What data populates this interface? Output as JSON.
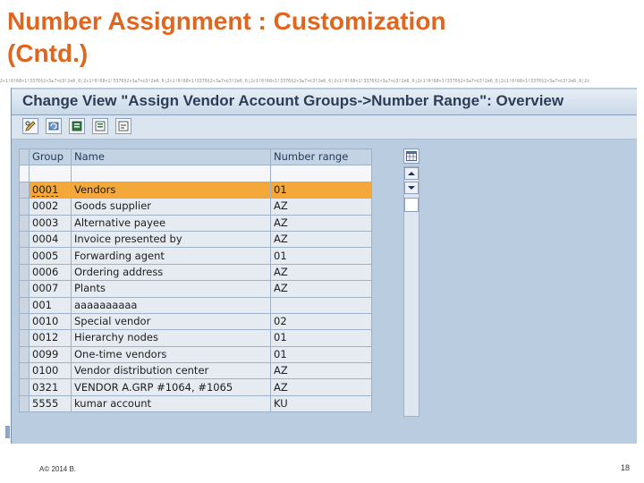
{
  "slide": {
    "title_line1": "Number Assignment : Customization",
    "title_line2": "(Cntd.)",
    "noise_text": "2×1!0!68×1!3376§2×3±7×©3!2e6¸6¦2c1!0!68×1!3376§2×3±7×©3!2e6¸6¦2c1!0!68×1!3376§2×3±7×©3!2e6¸6¦2c1!0!68×1!3376§2×3±7×©3!2e6¸6¦2c1!0!68×1!3376§2×3±7×©3!2e6¸6¦2c1!0!68×1!3376§2×3±7×©3!2e6¸6¦2c1!0!68×1!3376§2×3±7×©3!2e6¸6¦2c",
    "footer_left": "A© 2014 B.",
    "page_number": "18"
  },
  "window": {
    "title": "Change View \"Assign Vendor Account Groups->Number Range\": Overview"
  },
  "toolbar": {
    "buttons": [
      "pencil-glasses-icon",
      "refresh-icon",
      "export-icon",
      "import-icon",
      "details-icon"
    ]
  },
  "table": {
    "headers": {
      "group": "Group",
      "name": "Name",
      "range": "Number range"
    },
    "rows": [
      {
        "group": "0001",
        "name": "Vendors",
        "range": "01"
      },
      {
        "group": "0002",
        "name": "Goods supplier",
        "range": "AZ"
      },
      {
        "group": "0003",
        "name": "Alternative payee",
        "range": "AZ"
      },
      {
        "group": "0004",
        "name": "Invoice presented by",
        "range": "AZ"
      },
      {
        "group": "0005",
        "name": "Forwarding agent",
        "range": "01"
      },
      {
        "group": "0006",
        "name": "Ordering address",
        "range": "AZ"
      },
      {
        "group": "0007",
        "name": "Plants",
        "range": "AZ"
      },
      {
        "group": "001",
        "name": "aaaaaaaaaa",
        "range": ""
      },
      {
        "group": "0010",
        "name": "Special vendor",
        "range": "02"
      },
      {
        "group": "0012",
        "name": "Hierarchy nodes",
        "range": "01"
      },
      {
        "group": "0099",
        "name": "One-time vendors",
        "range": "01"
      },
      {
        "group": "0100",
        "name": "Vendor distribution center",
        "range": "AZ"
      },
      {
        "group": "0321",
        "name": "VENDOR A.GRP #1064, #1065",
        "range": "AZ"
      },
      {
        "group": "5555",
        "name": "kumar account",
        "range": "KU"
      }
    ],
    "selected_row": 0
  },
  "colors": {
    "title_orange": "#e0661f",
    "selection": "#f4a83a",
    "window_bg": "#b9cce0"
  }
}
